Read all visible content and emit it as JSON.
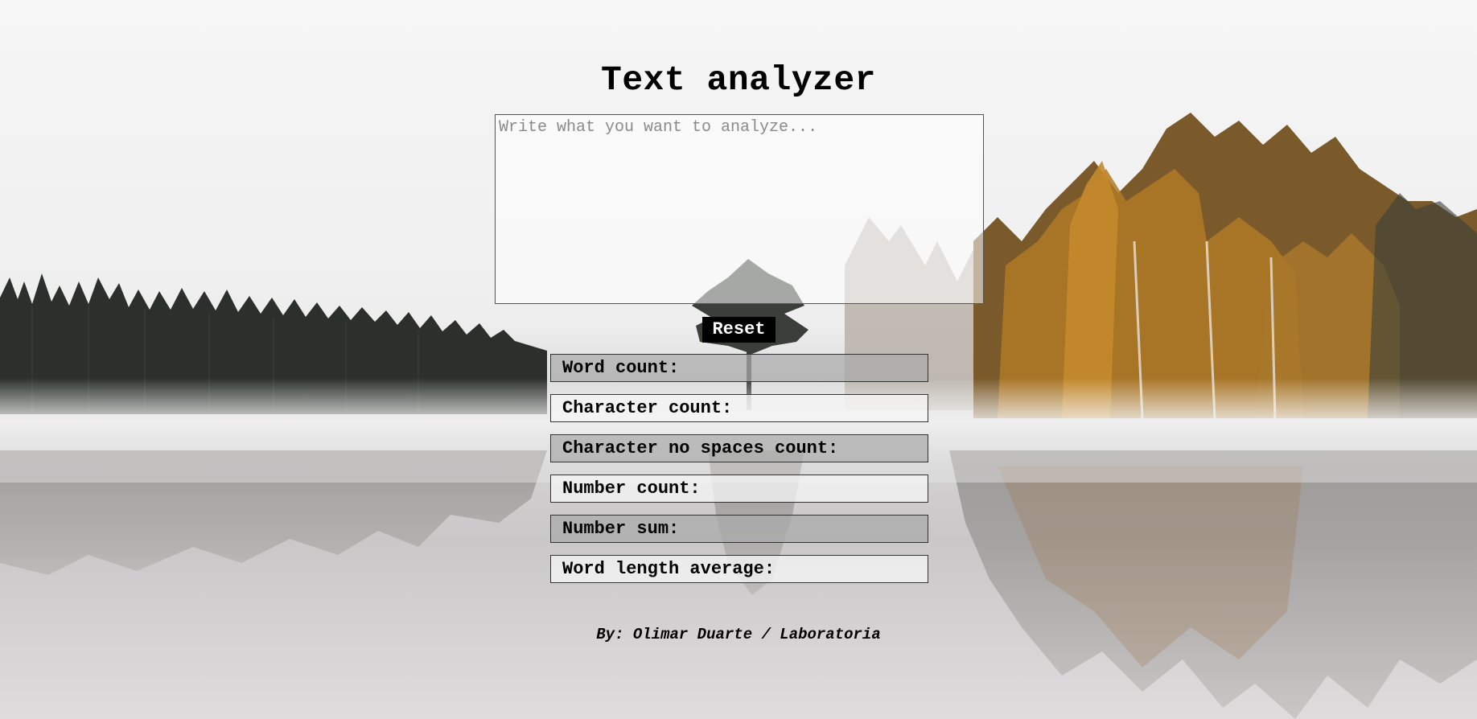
{
  "page": {
    "title": "Text analyzer",
    "background": "misty-lake-forest-photo"
  },
  "analyzer": {
    "input_value": "",
    "input_placeholder": "Write what you want to analyze...",
    "reset_label": "Reset"
  },
  "metrics": [
    {
      "label": "Word count:",
      "value": ""
    },
    {
      "label": "Character count:",
      "value": ""
    },
    {
      "label": "Character no spaces count:",
      "value": ""
    },
    {
      "label": "Number count:",
      "value": ""
    },
    {
      "label": "Number sum:",
      "value": ""
    },
    {
      "label": "Word length average:",
      "value": ""
    }
  ],
  "footer": {
    "credit": "By: Olimar Duarte / Laboratoria"
  },
  "colors": {
    "text": "#000000",
    "button_bg": "#000000",
    "button_text": "#ffffff",
    "metric_dark_bg": "#aaaaaa",
    "metric_light_bg": "#f5f5f5"
  }
}
